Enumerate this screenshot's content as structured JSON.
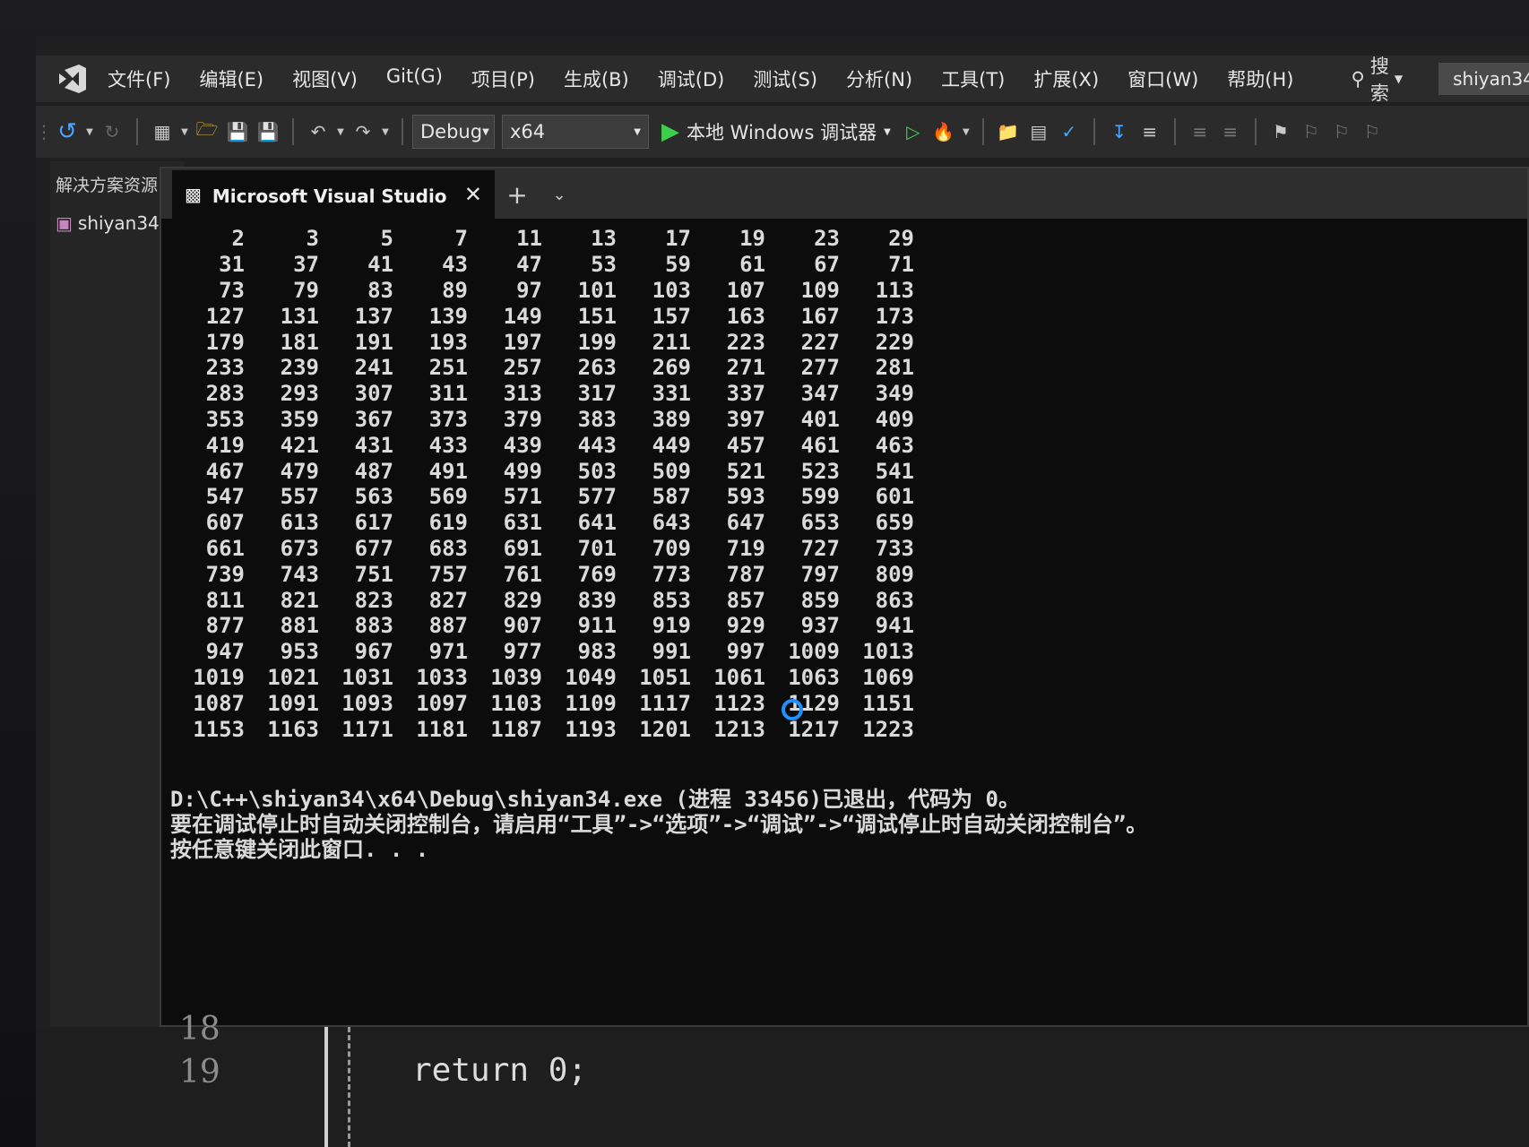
{
  "menubar": {
    "items": [
      "文件(F)",
      "编辑(E)",
      "视图(V)",
      "Git(G)",
      "项目(P)",
      "生成(B)",
      "调试(D)",
      "测试(S)",
      "分析(N)",
      "工具(T)",
      "扩展(X)",
      "窗口(W)",
      "帮助(H)"
    ],
    "search_label": "搜索",
    "user": "shiyan34"
  },
  "toolbar": {
    "config": "Debug",
    "platform": "x64",
    "run_label": "本地 Windows 调试器"
  },
  "solution_explorer": {
    "title": "解决方案资源",
    "project": "shiyan34"
  },
  "console": {
    "tab_title": "Microsoft Visual Studio 调试控制台",
    "rows": [
      [
        "2",
        "3",
        "5",
        "7",
        "11",
        "13",
        "17",
        "19",
        "23",
        "29"
      ],
      [
        "31",
        "37",
        "41",
        "43",
        "47",
        "53",
        "59",
        "61",
        "67",
        "71"
      ],
      [
        "73",
        "79",
        "83",
        "89",
        "97",
        "101",
        "103",
        "107",
        "109",
        "113"
      ],
      [
        "127",
        "131",
        "137",
        "139",
        "149",
        "151",
        "157",
        "163",
        "167",
        "173"
      ],
      [
        "179",
        "181",
        "191",
        "193",
        "197",
        "199",
        "211",
        "223",
        "227",
        "229"
      ],
      [
        "233",
        "239",
        "241",
        "251",
        "257",
        "263",
        "269",
        "271",
        "277",
        "281"
      ],
      [
        "283",
        "293",
        "307",
        "311",
        "313",
        "317",
        "331",
        "337",
        "347",
        "349"
      ],
      [
        "353",
        "359",
        "367",
        "373",
        "379",
        "383",
        "389",
        "397",
        "401",
        "409"
      ],
      [
        "419",
        "421",
        "431",
        "433",
        "439",
        "443",
        "449",
        "457",
        "461",
        "463"
      ],
      [
        "467",
        "479",
        "487",
        "491",
        "499",
        "503",
        "509",
        "521",
        "523",
        "541"
      ],
      [
        "547",
        "557",
        "563",
        "569",
        "571",
        "577",
        "587",
        "593",
        "599",
        "601"
      ],
      [
        "607",
        "613",
        "617",
        "619",
        "631",
        "641",
        "643",
        "647",
        "653",
        "659"
      ],
      [
        "661",
        "673",
        "677",
        "683",
        "691",
        "701",
        "709",
        "719",
        "727",
        "733"
      ],
      [
        "739",
        "743",
        "751",
        "757",
        "761",
        "769",
        "773",
        "787",
        "797",
        "809"
      ],
      [
        "811",
        "821",
        "823",
        "827",
        "829",
        "839",
        "853",
        "857",
        "859",
        "863"
      ],
      [
        "877",
        "881",
        "883",
        "887",
        "907",
        "911",
        "919",
        "929",
        "937",
        "941"
      ],
      [
        "947",
        "953",
        "967",
        "971",
        "977",
        "983",
        "991",
        "997",
        "1009",
        "1013"
      ],
      [
        "1019",
        "1021",
        "1031",
        "1033",
        "1039",
        "1049",
        "1051",
        "1061",
        "1063",
        "1069"
      ],
      [
        "1087",
        "1091",
        "1093",
        "1097",
        "1103",
        "1109",
        "1117",
        "1123",
        "1129",
        "1151"
      ],
      [
        "1153",
        "1163",
        "1171",
        "1181",
        "1187",
        "1193",
        "1201",
        "1213",
        "1217",
        "1223"
      ]
    ],
    "exit_line": "D:\\C++\\shiyan34\\x64\\Debug\\shiyan34.exe (进程 33456)已退出，代码为 0。",
    "hint_line": "要在调试停止时自动关闭控制台，请启用“工具”->“选项”->“调试”->“调试停止时自动关闭控制台”。",
    "press_line": "按任意键关闭此窗口. . ."
  },
  "editor": {
    "line_prev": "18",
    "line_no": "19",
    "code": "return 0;"
  }
}
